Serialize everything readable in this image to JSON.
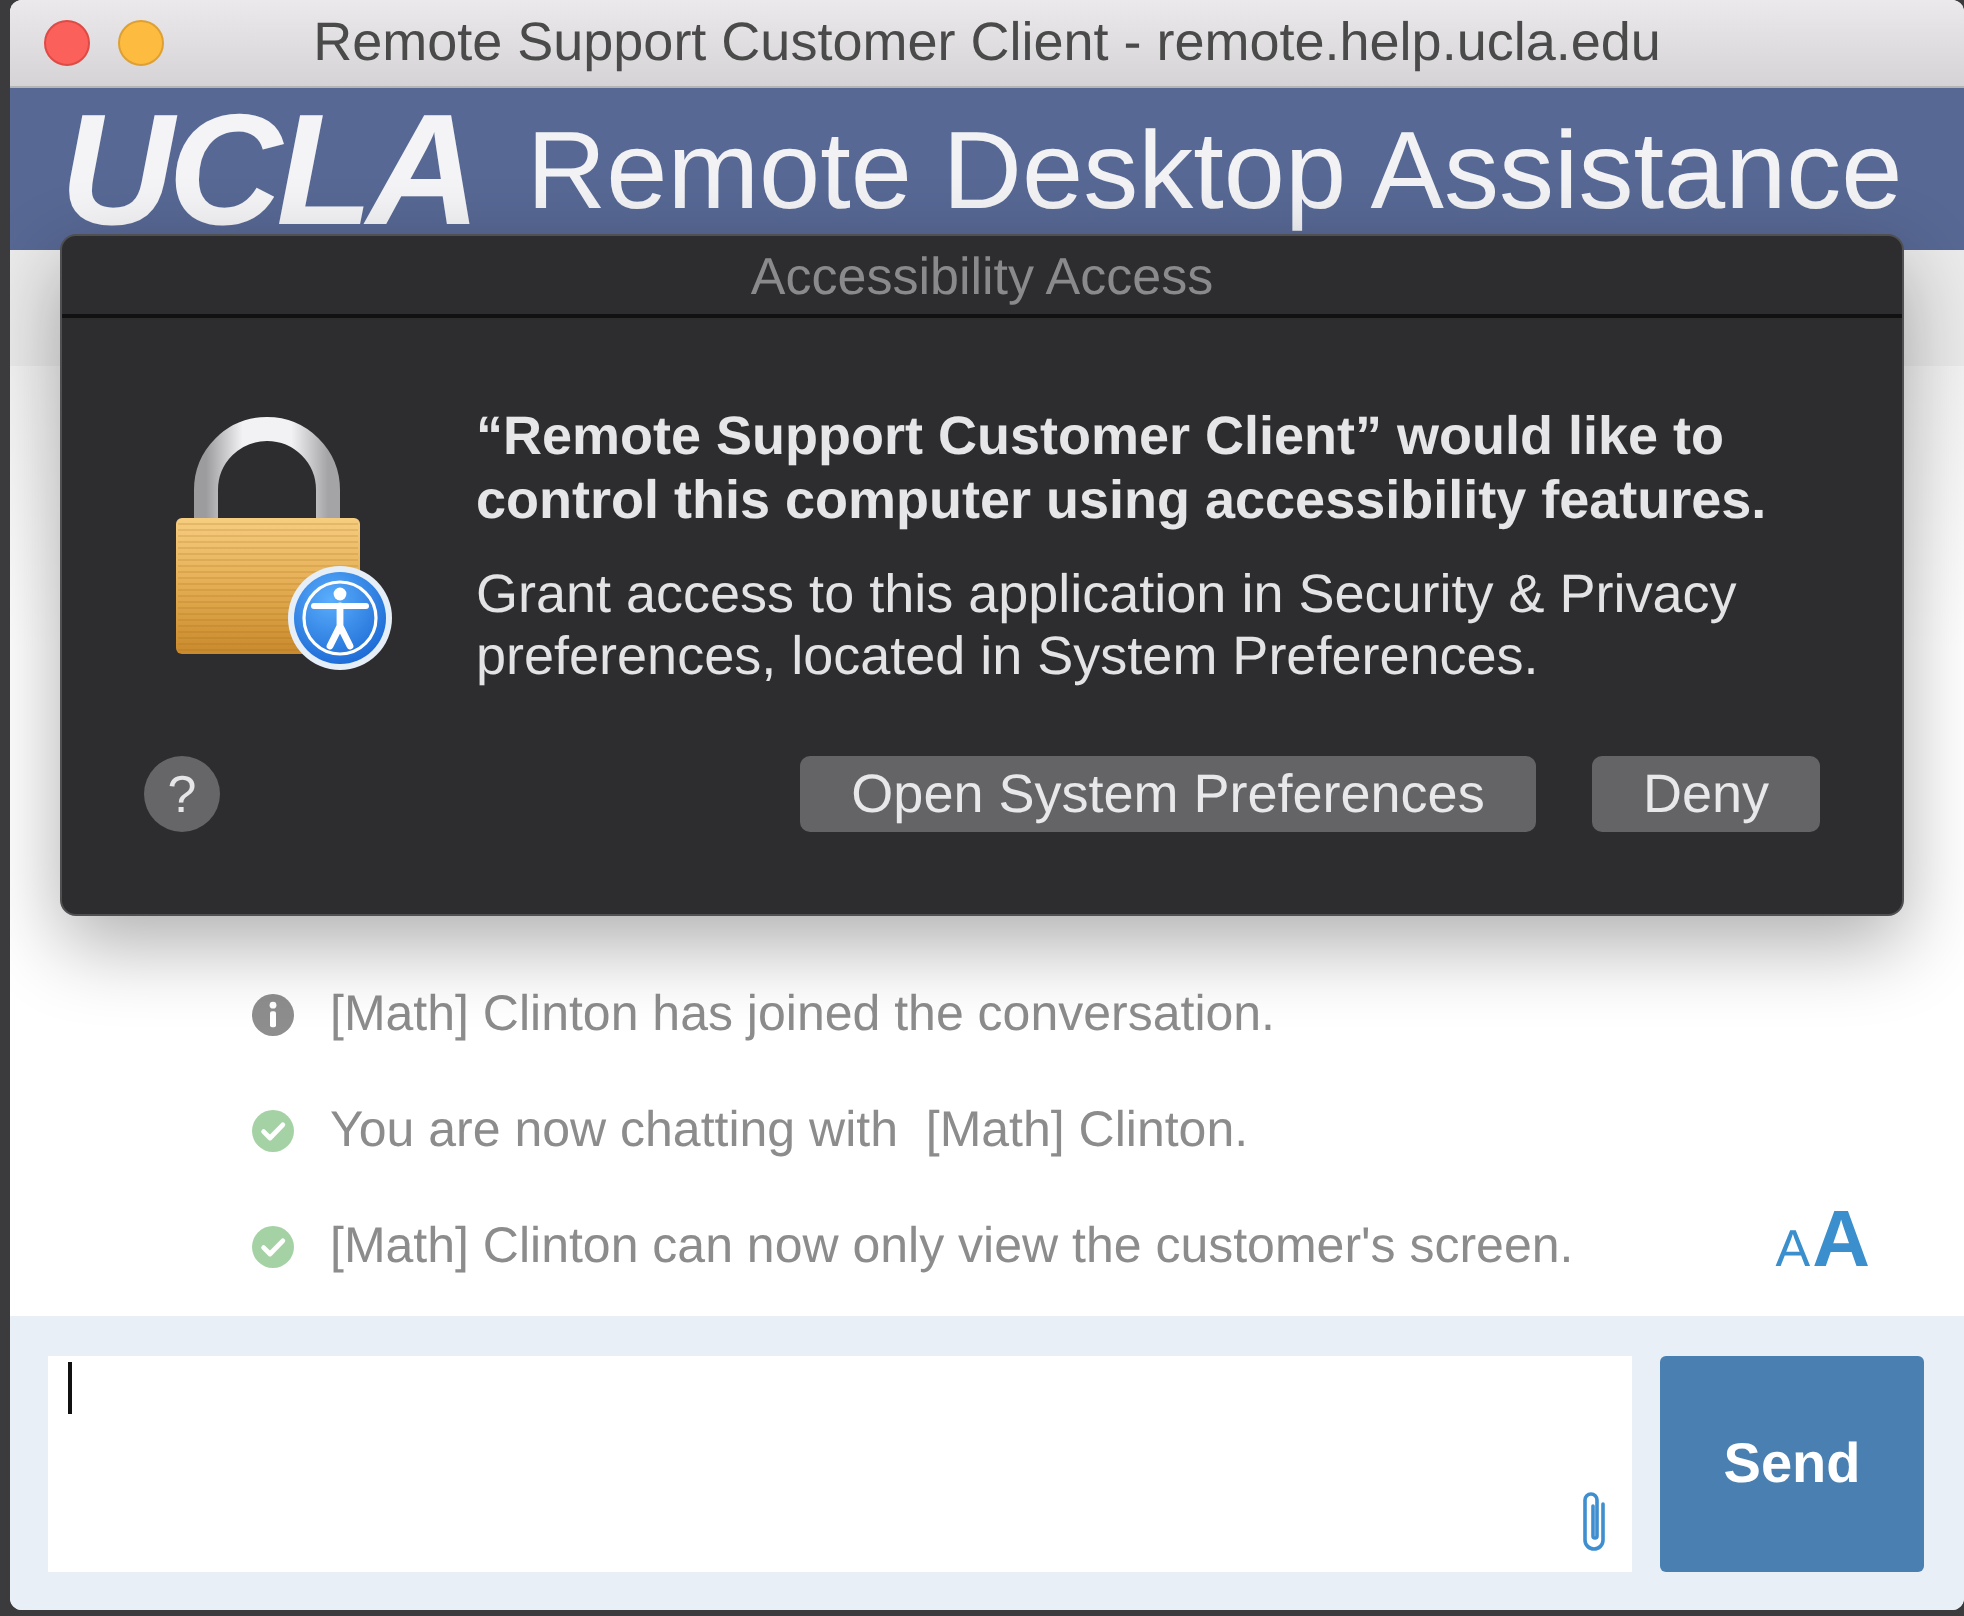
{
  "window": {
    "title": "Remote Support Customer Client - remote.help.ucla.edu"
  },
  "header": {
    "logo": "UCLA",
    "title": "Remote Desktop Assistance"
  },
  "dialog": {
    "title": "Accessibility Access",
    "heading": "“Remote Support Customer Client” would like to control this computer using accessibility features.",
    "message": "Grant access to this application in Security & Privacy preferences, located in System Preferences.",
    "help_button": "?",
    "buttons": [
      "Open System Preferences",
      "Deny"
    ]
  },
  "chat": {
    "messages": [
      {
        "kind": "info",
        "text": "[Math] Clinton has joined the conversation."
      },
      {
        "kind": "success",
        "text": "You are now chatting with  [Math] Clinton."
      },
      {
        "kind": "success",
        "text": "[Math] Clinton can now only view the customer's screen."
      }
    ],
    "font_size_control": {
      "small": "A",
      "large": "A"
    }
  },
  "composer": {
    "send_button": "Send"
  }
}
